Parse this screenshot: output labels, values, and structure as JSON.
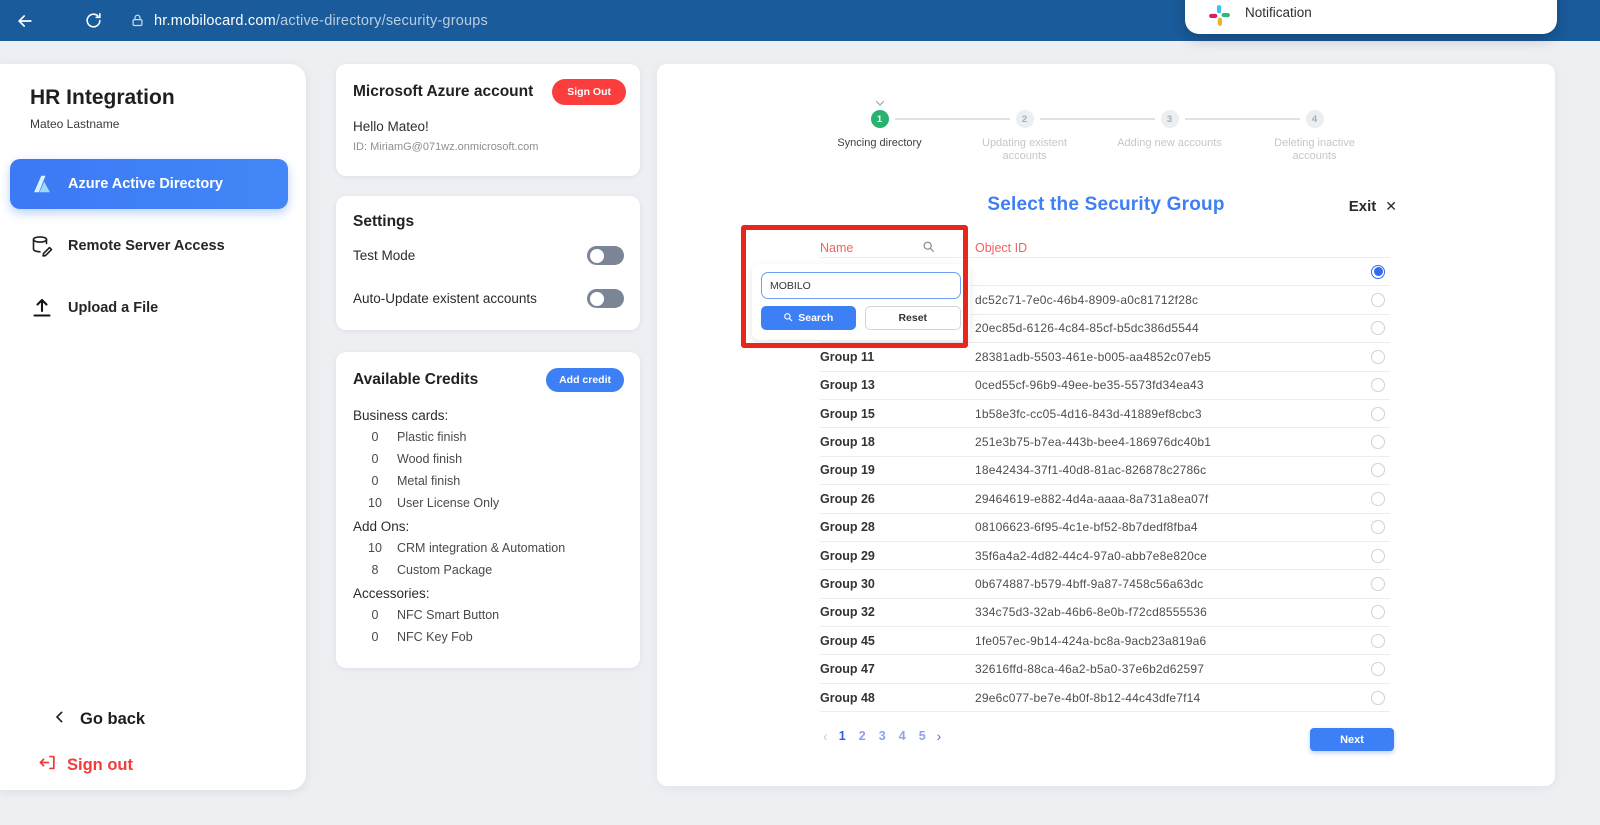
{
  "browser": {
    "host": "hr.mobilocard.com",
    "path": "/active-directory/security-groups",
    "notification_label": "Notification"
  },
  "sidebar": {
    "title": "HR Integration",
    "subtitle": "Mateo Lastname",
    "items": [
      {
        "label": "Azure Active Directory",
        "icon": "azure-icon",
        "active": true
      },
      {
        "label": "Remote Server Access",
        "icon": "server-edit-icon",
        "active": false
      },
      {
        "label": "Upload a File",
        "icon": "upload-icon",
        "active": false
      }
    ],
    "go_back_label": "Go back",
    "sign_out_label": "Sign out"
  },
  "account_card": {
    "title": "Microsoft Azure account",
    "sign_out_button": "Sign Out",
    "greeting": "Hello Mateo!",
    "id_line": "ID: MiriamG@071wz.onmicrosoft.com"
  },
  "settings_card": {
    "title": "Settings",
    "toggles": [
      {
        "label": "Test Mode",
        "on": false
      },
      {
        "label": "Auto-Update existent accounts",
        "on": false
      }
    ]
  },
  "credits_card": {
    "title": "Available Credits",
    "add_credit_button": "Add credit",
    "sections": [
      {
        "heading": "Business cards:",
        "items": [
          {
            "qty": "0",
            "label": "Plastic finish"
          },
          {
            "qty": "0",
            "label": "Wood finish"
          },
          {
            "qty": "0",
            "label": "Metal finish"
          },
          {
            "qty": "10",
            "label": "User License Only"
          }
        ]
      },
      {
        "heading": "Add Ons:",
        "items": [
          {
            "qty": "10",
            "label": "CRM integration & Automation"
          },
          {
            "qty": "8",
            "label": "Custom Package"
          }
        ]
      },
      {
        "heading": "Accessories:",
        "items": [
          {
            "qty": "0",
            "label": "NFC Smart Button"
          },
          {
            "qty": "0",
            "label": "NFC Key Fob"
          }
        ]
      }
    ]
  },
  "main": {
    "stepper": [
      {
        "num": "1",
        "label": "Syncing directory",
        "state": "active"
      },
      {
        "num": "2",
        "label": "Updating existent accounts",
        "state": "pending"
      },
      {
        "num": "3",
        "label": "Adding new accounts",
        "state": "pending"
      },
      {
        "num": "4",
        "label": "Deleting inactive accounts",
        "state": "pending"
      }
    ],
    "title": "Select the Security Group",
    "exit_label": "Exit",
    "exit_close_glyph": "✕",
    "table": {
      "name_header": "Name",
      "object_id_header": "Object ID",
      "search_value": "MOBILO",
      "search_button_label": "Search",
      "reset_button_label": "Reset",
      "rows": [
        {
          "name": "",
          "object_id": "",
          "selected": true
        },
        {
          "name": "",
          "object_id": "dc52c71-7e0c-46b4-8909-a0c81712f28c",
          "selected": false
        },
        {
          "name": "",
          "object_id": "20ec85d-6126-4c84-85cf-b5dc386d5544",
          "selected": false
        },
        {
          "name": "Group 11",
          "object_id": "28381adb-5503-461e-b005-aa4852c07eb5",
          "selected": false
        },
        {
          "name": "Group 13",
          "object_id": "0ced55cf-96b9-49ee-be35-5573fd34ea43",
          "selected": false
        },
        {
          "name": "Group 15",
          "object_id": "1b58e3fc-cc05-4d16-843d-41889ef8cbc3",
          "selected": false
        },
        {
          "name": "Group 18",
          "object_id": "251e3b75-b7ea-443b-bee4-186976dc40b1",
          "selected": false
        },
        {
          "name": "Group 19",
          "object_id": "18e42434-37f1-40d8-81ac-826878c2786c",
          "selected": false
        },
        {
          "name": "Group 26",
          "object_id": "29464619-e882-4d4a-aaaa-8a731a8ea07f",
          "selected": false
        },
        {
          "name": "Group 28",
          "object_id": "08106623-6f95-4c1e-bf52-8b7dedf8fba4",
          "selected": false
        },
        {
          "name": "Group 29",
          "object_id": "35f6a4a2-4d82-44c4-97a0-abb7e8e820ce",
          "selected": false
        },
        {
          "name": "Group 30",
          "object_id": "0b674887-b579-4bff-9a87-7458c56a63dc",
          "selected": false
        },
        {
          "name": "Group 32",
          "object_id": "334c75d3-32ab-46b6-8e0b-f72cd8555536",
          "selected": false
        },
        {
          "name": "Group 45",
          "object_id": "1fe057ec-9b14-424a-bc8a-9acb23a819a6",
          "selected": false
        },
        {
          "name": "Group 47",
          "object_id": "32616ffd-88ca-46a2-b5a0-37e6b2d62597",
          "selected": false
        },
        {
          "name": "Group 48",
          "object_id": "29e6c077-be7e-4b0f-8b12-44c43dfe7f14",
          "selected": false
        }
      ]
    },
    "pagination": {
      "prev_glyph": "‹",
      "next_glyph": "›",
      "pages": [
        "1",
        "2",
        "3",
        "4",
        "5"
      ],
      "active_page": "1"
    },
    "next_button": "Next"
  },
  "colors": {
    "accent_blue": "#3d7ff5",
    "alert_red": "#fb3d3d",
    "annotation_red": "#e7271d",
    "step_green": "#27b36f",
    "column_header_red": "#ef6363",
    "topbar_blue": "#1a5b9b"
  }
}
